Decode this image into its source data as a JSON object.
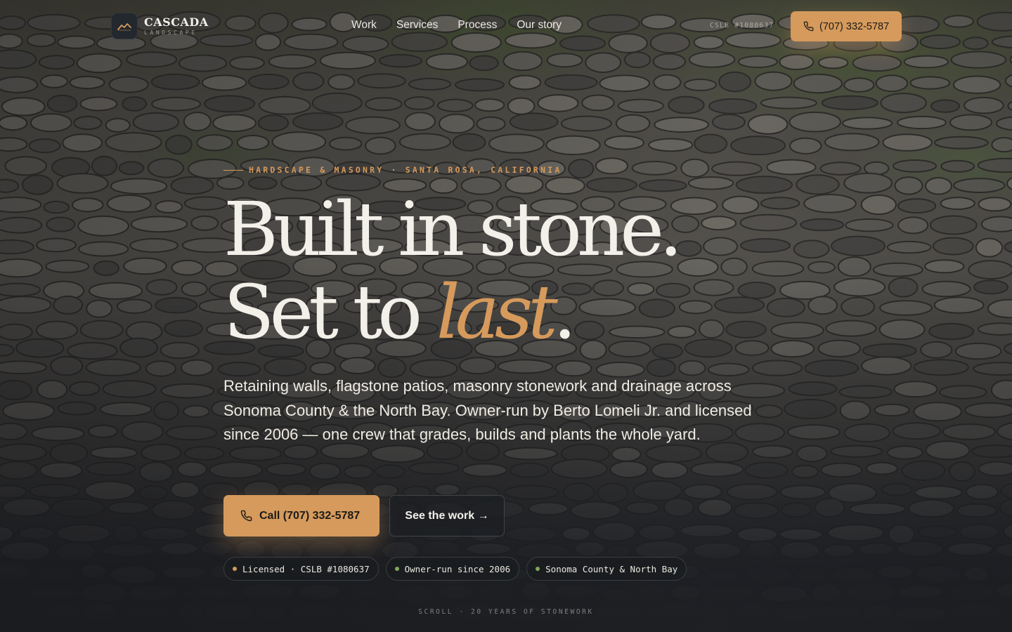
{
  "brand": {
    "name": "CASCADA",
    "tagline": "LANDSCAPE",
    "logo_icon": "mountain-chart-icon"
  },
  "nav": {
    "items": [
      {
        "label": "Work"
      },
      {
        "label": "Services"
      },
      {
        "label": "Process"
      },
      {
        "label": "Our story"
      }
    ]
  },
  "header": {
    "license": "CSLB #1080637",
    "call_label": "(707) 332-5787",
    "call_icon": "phone-icon"
  },
  "hero": {
    "eyebrow": "HARDSCAPE & MASONRY · SANTA ROSA, CALIFORNIA",
    "headline_line1": "Built in stone.",
    "headline_line2_start": "Set to ",
    "headline_accent": "last",
    "headline_line2_end": ".",
    "lede": "Retaining walls, flagstone patios, masonry stonework and drainage across Sonoma County & the North Bay. Owner-run by Berto Lomeli Jr. and licensed since 2006 — one crew that grades, builds and plants the whole yard.",
    "cta_call_label": "Call (707) 332-5787",
    "cta_work_label": "See the work →",
    "badges": [
      {
        "label": "Licensed · CSLB #1080637",
        "dot_color": "#d59a5c"
      },
      {
        "label": "Owner-run since 2006",
        "dot_color": "#7fa85a"
      },
      {
        "label": "Sonoma County & North Bay",
        "dot_color": "#7fa85a"
      }
    ],
    "scroll_hint": "SCROLL · 20 YEARS OF STONEWORK"
  },
  "colors": {
    "accent": "#d59a5c",
    "text": "#f3f0ea",
    "background": "#1e2024",
    "badge_green": "#7fa85a"
  }
}
